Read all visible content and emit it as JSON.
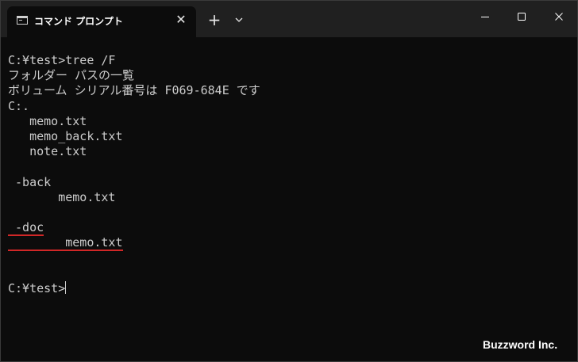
{
  "window": {
    "tab_title": "コマンド プロンプト",
    "tab_close_glyph": "✕",
    "new_tab_glyph": "+",
    "icons": {
      "tab": "terminal-icon",
      "dropdown": "chevron-down-icon",
      "minimize": "minimize-icon",
      "maximize": "maximize-icon",
      "close": "close-icon"
    }
  },
  "console": {
    "text_color": "#cccccc",
    "background": "#0c0c0c",
    "highlight_color": "#d12727",
    "lines": [
      "C:¥test>tree /F",
      "フォルダー パスの一覧",
      "ボリューム シリアル番号は F069-684E です",
      "C:.",
      "   memo.txt",
      "   memo_back.txt",
      "   note.txt",
      "",
      " -back",
      "       memo.txt",
      "",
      " -doc",
      "        memo.txt",
      "",
      "",
      "C:¥test>"
    ]
  },
  "watermark": "Buzzword Inc."
}
